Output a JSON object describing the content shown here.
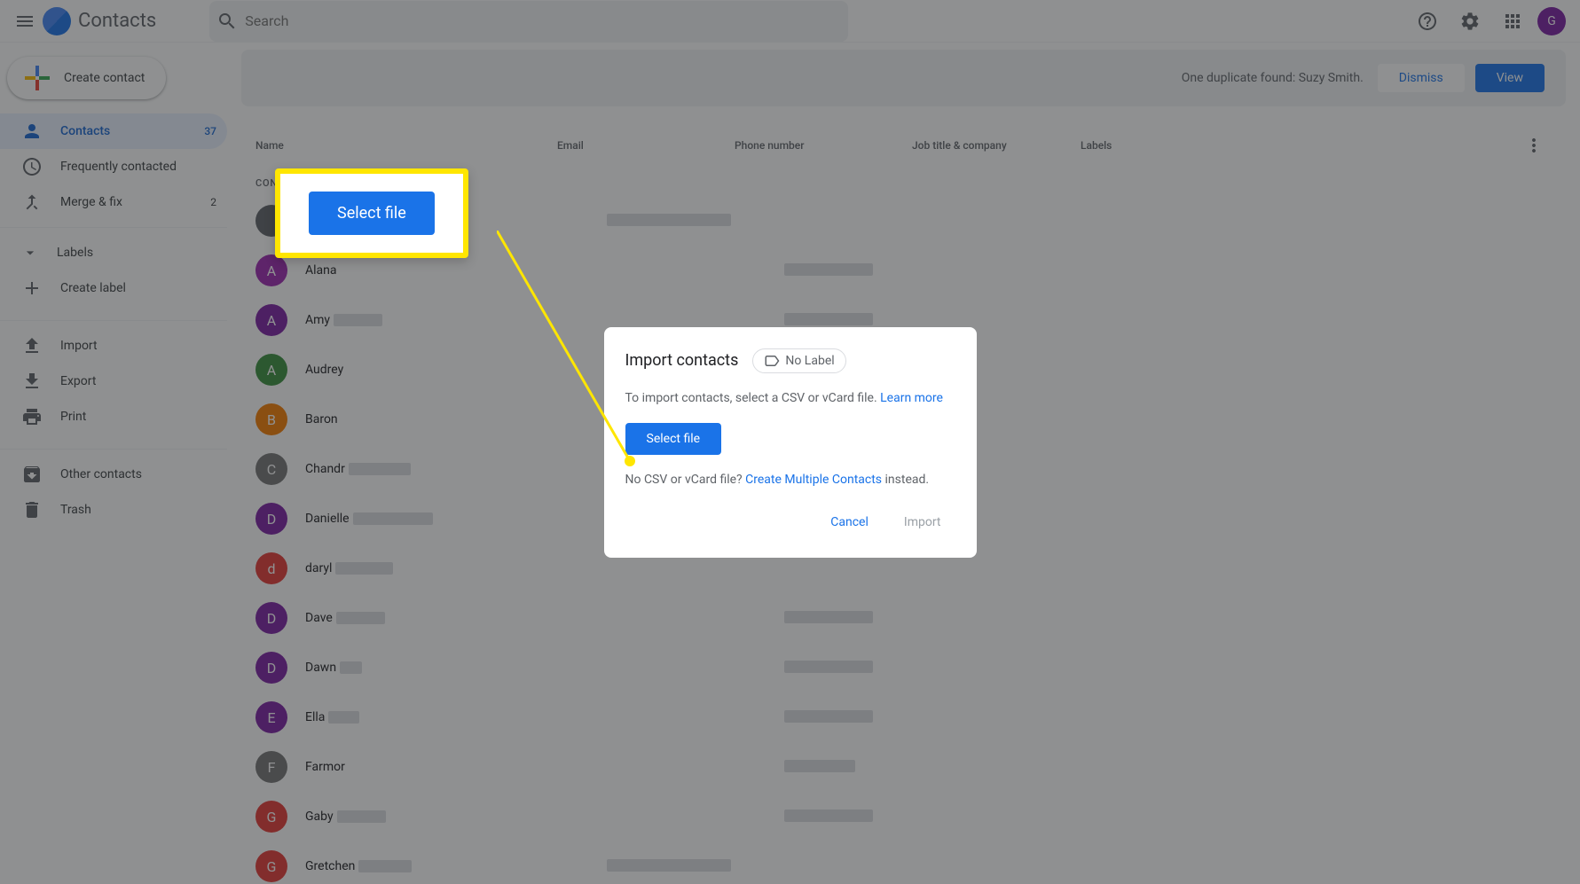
{
  "header": {
    "app_name": "Contacts",
    "search_placeholder": "Search"
  },
  "sidebar": {
    "create_contact": "Create contact",
    "items": [
      {
        "label": "Contacts",
        "count": "37",
        "icon": "person"
      },
      {
        "label": "Frequently contacted",
        "icon": "clock"
      },
      {
        "label": "Merge & fix",
        "count": "2",
        "icon": "merge"
      }
    ],
    "labels_header": "Labels",
    "create_label": "Create label",
    "tools": [
      {
        "label": "Import",
        "icon": "upload"
      },
      {
        "label": "Export",
        "icon": "download"
      },
      {
        "label": "Print",
        "icon": "print"
      }
    ],
    "other": [
      {
        "label": "Other contacts",
        "icon": "archive"
      },
      {
        "label": "Trash",
        "icon": "trash"
      }
    ]
  },
  "banner": {
    "text": "One duplicate found: Suzy Smith.",
    "dismiss": "Dismiss",
    "view": "View"
  },
  "table": {
    "columns": {
      "name": "Name",
      "email": "Email",
      "phone": "Phone number",
      "job": "Job title & company",
      "labels": "Labels"
    },
    "section_label": "CONTACTS (37)"
  },
  "contacts": [
    {
      "initial": "",
      "name": "",
      "color": "#5f6368",
      "name_redact_w": 0,
      "email_redact_w": 140,
      "phone_redact_w": 0
    },
    {
      "initial": "A",
      "name": "Alana",
      "color": "#9c27b0",
      "name_redact_w": 0,
      "email_redact_w": 0,
      "phone_redact_w": 100
    },
    {
      "initial": "A",
      "name": "Amy",
      "color": "#7b1fa2",
      "name_redact_w": 55,
      "email_redact_w": 0,
      "phone_redact_w": 100
    },
    {
      "initial": "A",
      "name": "Audrey",
      "color": "#388e3c",
      "name_redact_w": 0,
      "email_redact_w": 0,
      "phone_redact_w": 0
    },
    {
      "initial": "B",
      "name": "Baron",
      "color": "#f57c00",
      "name_redact_w": 0,
      "email_redact_w": 0,
      "phone_redact_w": 0
    },
    {
      "initial": "C",
      "name": "Chandr",
      "color": "#757575",
      "name_redact_w": 70,
      "email_redact_w": 0,
      "phone_redact_w": 0
    },
    {
      "initial": "D",
      "name": "Danielle",
      "color": "#7b1fa2",
      "name_redact_w": 90,
      "email_redact_w": 0,
      "phone_redact_w": 0
    },
    {
      "initial": "d",
      "name": "daryl",
      "color": "#e53935",
      "name_redact_w": 65,
      "email_redact_w": 0,
      "phone_redact_w": 0
    },
    {
      "initial": "D",
      "name": "Dave",
      "color": "#7b1fa2",
      "name_redact_w": 55,
      "email_redact_w": 0,
      "phone_redact_w": 100
    },
    {
      "initial": "D",
      "name": "Dawn",
      "color": "#7b1fa2",
      "name_redact_w": 25,
      "email_redact_w": 0,
      "phone_redact_w": 100
    },
    {
      "initial": "E",
      "name": "Ella",
      "color": "#7b1fa2",
      "name_redact_w": 35,
      "email_redact_w": 0,
      "phone_redact_w": 100
    },
    {
      "initial": "F",
      "name": "Farmor",
      "color": "#757575",
      "name_redact_w": 0,
      "email_redact_w": 0,
      "phone_redact_w": 80
    },
    {
      "initial": "G",
      "name": "Gaby",
      "color": "#e53935",
      "name_redact_w": 55,
      "email_redact_w": 0,
      "phone_redact_w": 100
    },
    {
      "initial": "G",
      "name": "Gretchen",
      "color": "#e53935",
      "name_redact_w": 60,
      "email_redact_w": 140,
      "phone_redact_w": 0
    }
  ],
  "dialog": {
    "title": "Import contacts",
    "no_label": "No Label",
    "instruction": "To import contacts, select a CSV or vCard file.",
    "learn_more": "Learn more",
    "select_file": "Select file",
    "no_file_text": "No CSV or vCard file?",
    "create_multiple": "Create Multiple Contacts",
    "instead": "instead.",
    "cancel": "Cancel",
    "import": "Import"
  },
  "callout": {
    "select_file": "Select file"
  }
}
